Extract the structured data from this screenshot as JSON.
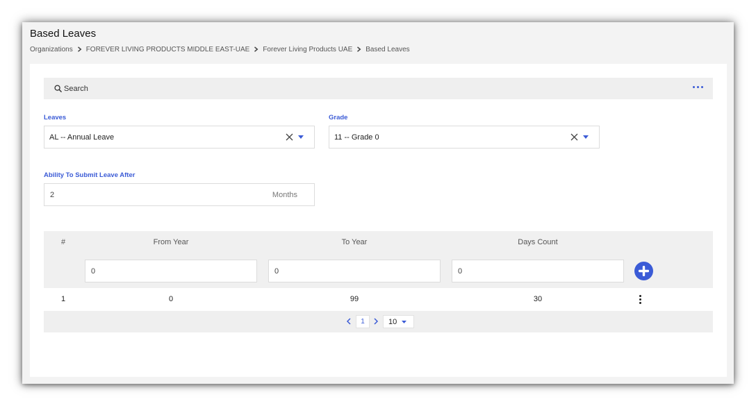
{
  "page": {
    "title": "Based Leaves",
    "breadcrumb": [
      "Organizations",
      "FOREVER LIVING PRODUCTS MIDDLE EAST-UAE",
      "Forever Living Products UAE",
      "Based Leaves"
    ]
  },
  "search": {
    "label": "Search"
  },
  "form": {
    "leaves": {
      "label": "Leaves",
      "value": "AL -- Annual Leave"
    },
    "grade": {
      "label": "Grade",
      "value": "11 -- Grade 0"
    },
    "submit_after": {
      "label": "Ability To Submit Leave After",
      "value": "2",
      "unit": "Months"
    }
  },
  "table": {
    "columns": [
      "#",
      "From Year",
      "To Year",
      "Days Count"
    ],
    "filters": {
      "from_year": "0",
      "to_year": "0",
      "days_count": "0"
    },
    "rows": [
      {
        "index": "1",
        "from_year": "0",
        "to_year": "99",
        "days_count": "30"
      }
    ]
  },
  "pagination": {
    "current_page": "1",
    "page_size": "10"
  },
  "colors": {
    "accent": "#3b5bd6",
    "panel": "#efefef",
    "border": "#dcdcdc"
  }
}
